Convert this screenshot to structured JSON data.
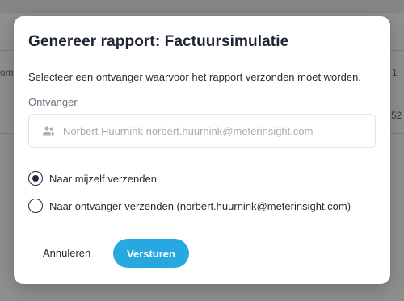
{
  "background": {
    "overlay_color": "#8a8a8a",
    "left_fragment_1": "om",
    "right_fragment_1": "1",
    "right_fragment_2": "52"
  },
  "dialog": {
    "title": "Genereer rapport: Factuursimulatie",
    "description": "Selecteer een ontvanger waarvoor het rapport verzonden moet worden.",
    "recipient_label": "Ontvanger",
    "recipient_icon": "users-icon",
    "recipient_value": "Norbert Huurnink norbert.huurnink@meterinsight.com",
    "options": [
      {
        "label": "Naar mijzelf verzenden",
        "selected": true
      },
      {
        "label": "Naar ontvanger verzenden (norbert.huurnink@meterinsight.com)",
        "selected": false
      }
    ],
    "cancel_label": "Annuleren",
    "send_label": "Versturen",
    "accent_color": "#27a8e0"
  }
}
